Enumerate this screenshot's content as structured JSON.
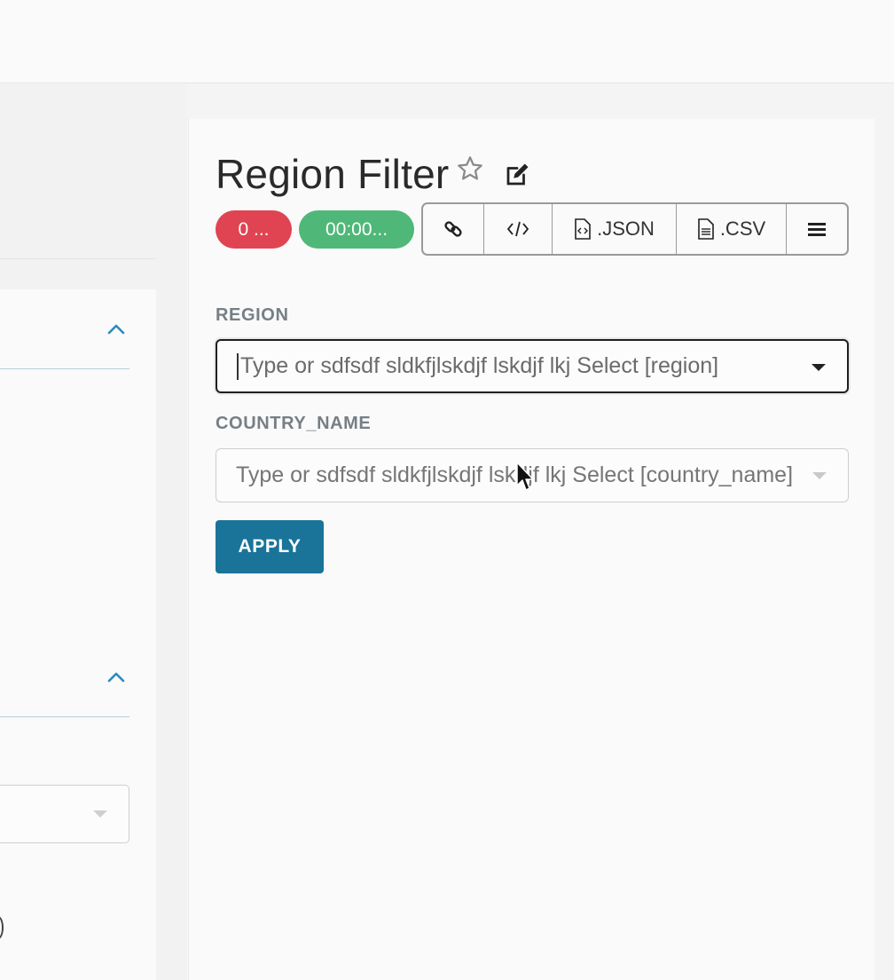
{
  "filter": {
    "title": "Region Filter",
    "badges": {
      "errors": "0 ...",
      "timer": "00:00..."
    },
    "toolbar": {
      "json_label": ".JSON",
      "csv_label": ".CSV"
    },
    "fields": [
      {
        "label": "REGION",
        "placeholder": "Type or sdfsdf sldkfjlskdjf lskdjf lkj Select [region]"
      },
      {
        "label": "COUNTRY_NAME",
        "placeholder": "Type or sdfsdf sldkfjlskdjf lskdjf lkj Select [country_name]"
      }
    ],
    "apply_label": "APPLY"
  },
  "colors": {
    "accent": "#1a7399",
    "error_badge": "#e04452",
    "timer_badge": "#4fb878",
    "chevron": "#2b8cbf"
  },
  "icons": {
    "favorite": "star-outline-icon",
    "edit": "edit-icon",
    "link": "link-icon",
    "embed": "code-icon",
    "json": "file-code-icon",
    "csv": "file-text-icon",
    "menu": "hamburger-menu-icon",
    "collapse": "chevron-up-icon",
    "dropdown": "caret-down-icon"
  }
}
